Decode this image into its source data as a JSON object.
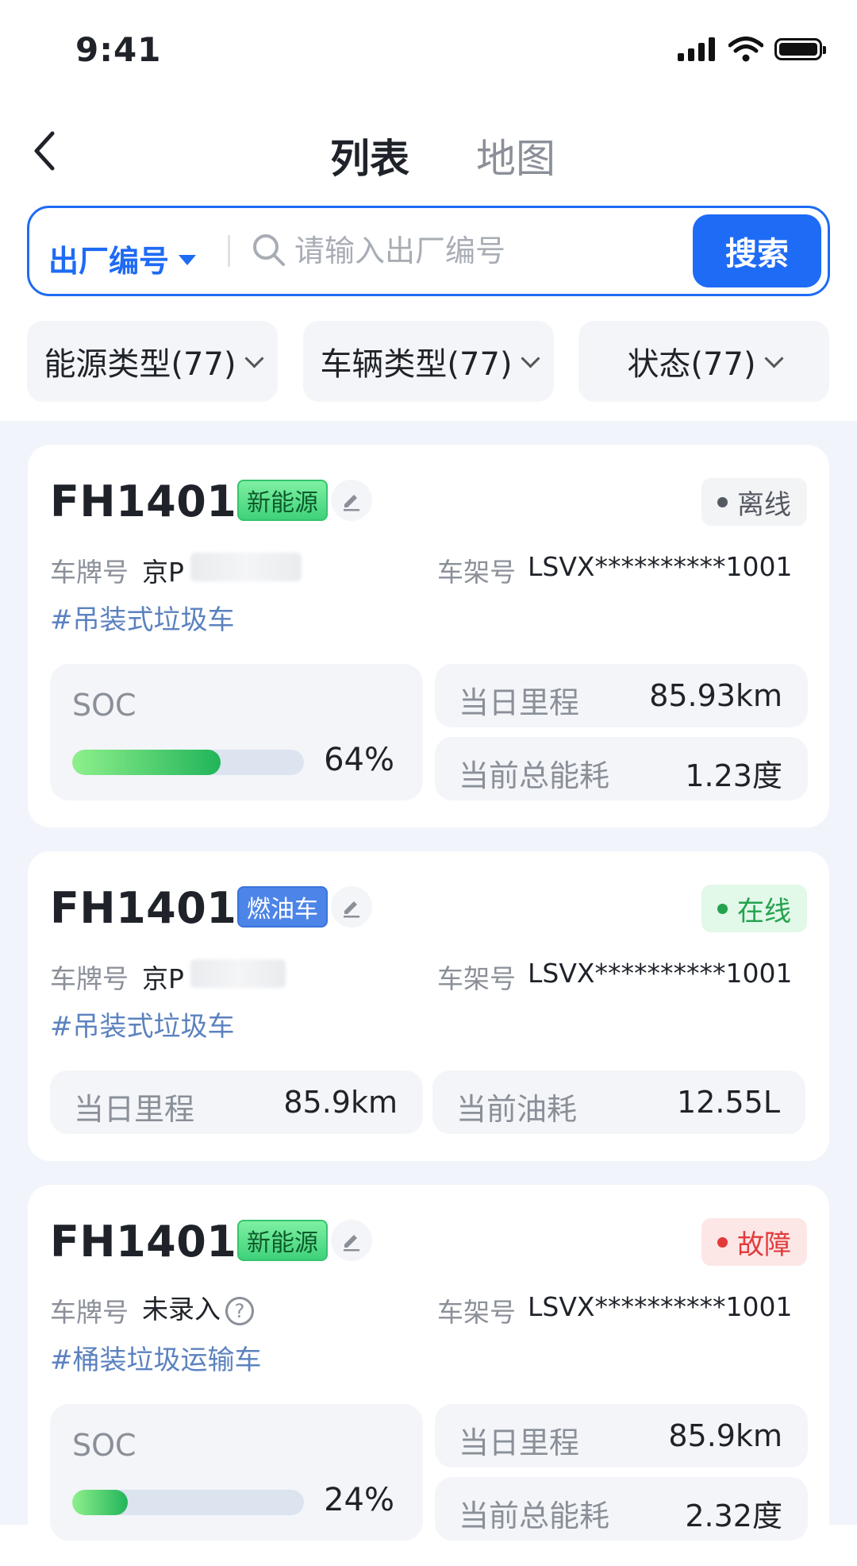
{
  "status_bar": {
    "time": "9:41"
  },
  "nav": {
    "tabs": [
      {
        "label": "列表",
        "active": true
      },
      {
        "label": "地图",
        "active": false
      }
    ]
  },
  "search": {
    "field_label": "出厂编号",
    "placeholder": "请输入出厂编号",
    "value": "",
    "button_label": "搜索"
  },
  "filters": [
    {
      "label": "能源类型(77)"
    },
    {
      "label": "车辆类型(77)"
    },
    {
      "label": "状态(77)"
    }
  ],
  "labels": {
    "plate": "车牌号",
    "vin": "车架号",
    "soc": "SOC",
    "daily_mileage": "当日里程",
    "total_energy": "当前总能耗",
    "fuel": "当前油耗"
  },
  "cards": [
    {
      "id": "FH14014",
      "energy_badge": "新能源",
      "status": "离线",
      "plate_prefix": "京P",
      "vin": "LSVX**********1001",
      "tag": "#吊装式垃圾车",
      "soc_percent": 64,
      "soc_text": "64%",
      "daily_mileage": "85.93km",
      "total_energy": "1.23度"
    },
    {
      "id": "FH14014",
      "energy_badge": "燃油车",
      "status": "在线",
      "plate_prefix": "京P",
      "vin": "LSVX**********1001",
      "tag": "#吊装式垃圾车",
      "daily_mileage": "85.9km",
      "fuel": "12.55L"
    },
    {
      "id": "FH14014",
      "energy_badge": "新能源",
      "status": "故障",
      "plate_text": "未录入",
      "vin": "LSVX**********1001",
      "tag": "#桶装垃圾运输车",
      "soc_percent": 24,
      "soc_text": "24%",
      "daily_mileage": "85.9km",
      "total_energy": "2.32度"
    }
  ],
  "colors": {
    "accent": "#1e6bf5",
    "online": "#24a24d",
    "fault": "#e23a3a",
    "offline": "#555a62"
  }
}
